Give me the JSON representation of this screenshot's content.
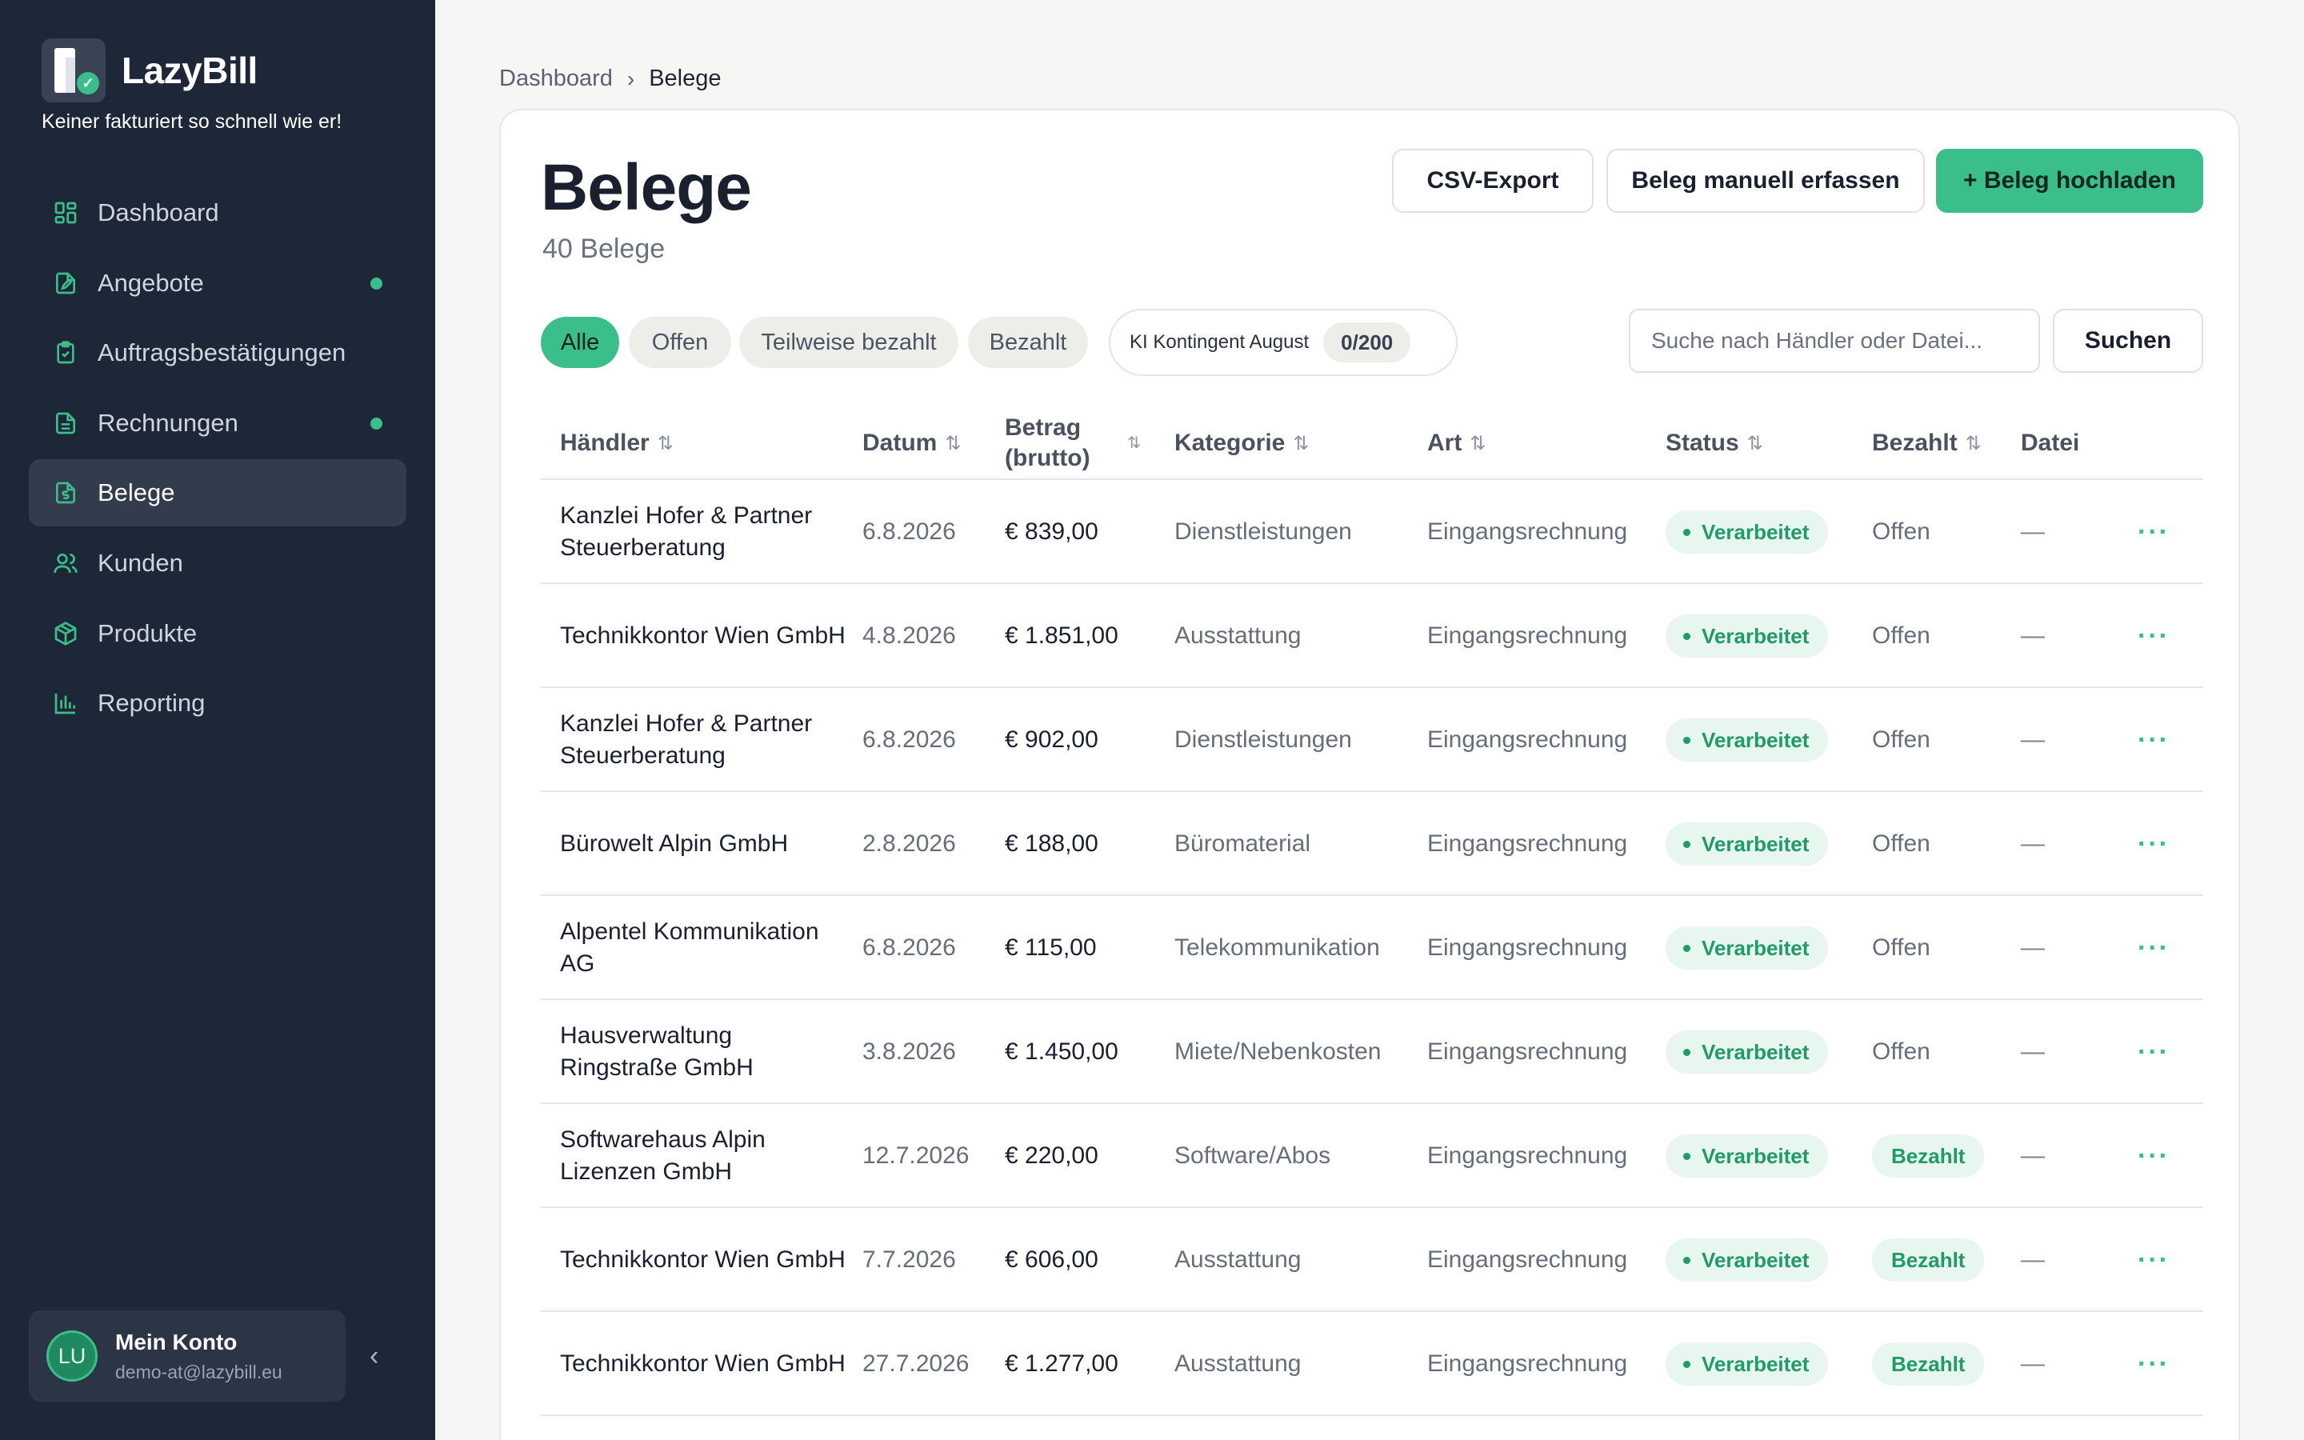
{
  "app": {
    "name": "LazyBill",
    "tagline": "Keiner fakturiert so schnell wie er!",
    "accent_color": "#3bbf8a",
    "sidebar_color": "#1e2737"
  },
  "sidebar": {
    "items": [
      {
        "label": "Dashboard",
        "icon": "dashboard-icon",
        "dot": false,
        "active": false
      },
      {
        "label": "Angebote",
        "icon": "document-edit-icon",
        "dot": true,
        "active": false
      },
      {
        "label": "Auftragsbestätigungen",
        "icon": "clipboard-check-icon",
        "dot": false,
        "active": false
      },
      {
        "label": "Rechnungen",
        "icon": "invoice-icon",
        "dot": true,
        "active": false
      },
      {
        "label": "Belege",
        "icon": "receipt-dollar-icon",
        "dot": false,
        "active": true
      },
      {
        "label": "Kunden",
        "icon": "users-icon",
        "dot": false,
        "active": false
      },
      {
        "label": "Produkte",
        "icon": "box-icon",
        "dot": false,
        "active": false
      },
      {
        "label": "Reporting",
        "icon": "bar-chart-icon",
        "dot": false,
        "active": false
      }
    ],
    "account": {
      "initials": "LU",
      "name": "Mein Konto",
      "email": "demo-at@lazybill.eu"
    }
  },
  "breadcrumb": {
    "parent": "Dashboard",
    "current": "Belege"
  },
  "header": {
    "title": "Belege",
    "subtitle": "40 Belege",
    "csv_export": "CSV-Export",
    "manual_entry": "Beleg manuell erfassen",
    "upload": "+ Beleg hochladen"
  },
  "filters": {
    "chips": [
      "Alle",
      "Offen",
      "Teilweise bezahlt",
      "Bezahlt"
    ],
    "active": "Alle",
    "quota_label": "KI Kontingent August",
    "quota_value": "0/200"
  },
  "search": {
    "placeholder": "Suche nach Händler oder Datei...",
    "button": "Suchen"
  },
  "table": {
    "columns": {
      "vendor": "Händler",
      "date": "Datum",
      "amount": "Betrag (brutto)",
      "category": "Kategorie",
      "type": "Art",
      "status": "Status",
      "paid": "Bezahlt",
      "file": "Datei"
    },
    "rows": [
      {
        "vendor": "Kanzlei Hofer & Partner Steuerberatung",
        "date": "6.8.2026",
        "amount": "€ 839,00",
        "category": "Dienstleistungen",
        "type": "Eingangsrechnung",
        "status": "Verarbeitet",
        "paid": "Offen",
        "file": "—"
      },
      {
        "vendor": "Technikkontor Wien GmbH",
        "date": "4.8.2026",
        "amount": "€ 1.851,00",
        "category": "Ausstattung",
        "type": "Eingangsrechnung",
        "status": "Verarbeitet",
        "paid": "Offen",
        "file": "—"
      },
      {
        "vendor": "Kanzlei Hofer & Partner Steuerberatung",
        "date": "6.8.2026",
        "amount": "€ 902,00",
        "category": "Dienstleistungen",
        "type": "Eingangsrechnung",
        "status": "Verarbeitet",
        "paid": "Offen",
        "file": "—"
      },
      {
        "vendor": "Bürowelt Alpin GmbH",
        "date": "2.8.2026",
        "amount": "€ 188,00",
        "category": "Büromaterial",
        "type": "Eingangsrechnung",
        "status": "Verarbeitet",
        "paid": "Offen",
        "file": "—"
      },
      {
        "vendor": "Alpentel Kommunikation AG",
        "date": "6.8.2026",
        "amount": "€ 115,00",
        "category": "Telekommunikation",
        "type": "Eingangsrechnung",
        "status": "Verarbeitet",
        "paid": "Offen",
        "file": "—"
      },
      {
        "vendor": "Hausverwaltung Ringstraße GmbH",
        "date": "3.8.2026",
        "amount": "€ 1.450,00",
        "category": "Miete/Nebenkosten",
        "type": "Eingangsrechnung",
        "status": "Verarbeitet",
        "paid": "Offen",
        "file": "—"
      },
      {
        "vendor": "Softwarehaus Alpin Lizenzen GmbH",
        "date": "12.7.2026",
        "amount": "€ 220,00",
        "category": "Software/Abos",
        "type": "Eingangsrechnung",
        "status": "Verarbeitet",
        "paid": "Bezahlt",
        "file": "—"
      },
      {
        "vendor": "Technikkontor Wien GmbH",
        "date": "7.7.2026",
        "amount": "€ 606,00",
        "category": "Ausstattung",
        "type": "Eingangsrechnung",
        "status": "Verarbeitet",
        "paid": "Bezahlt",
        "file": "—"
      },
      {
        "vendor": "Technikkontor Wien GmbH",
        "date": "27.7.2026",
        "amount": "€ 1.277,00",
        "category": "Ausstattung",
        "type": "Eingangsrechnung",
        "status": "Verarbeitet",
        "paid": "Bezahlt",
        "file": "—"
      }
    ]
  }
}
